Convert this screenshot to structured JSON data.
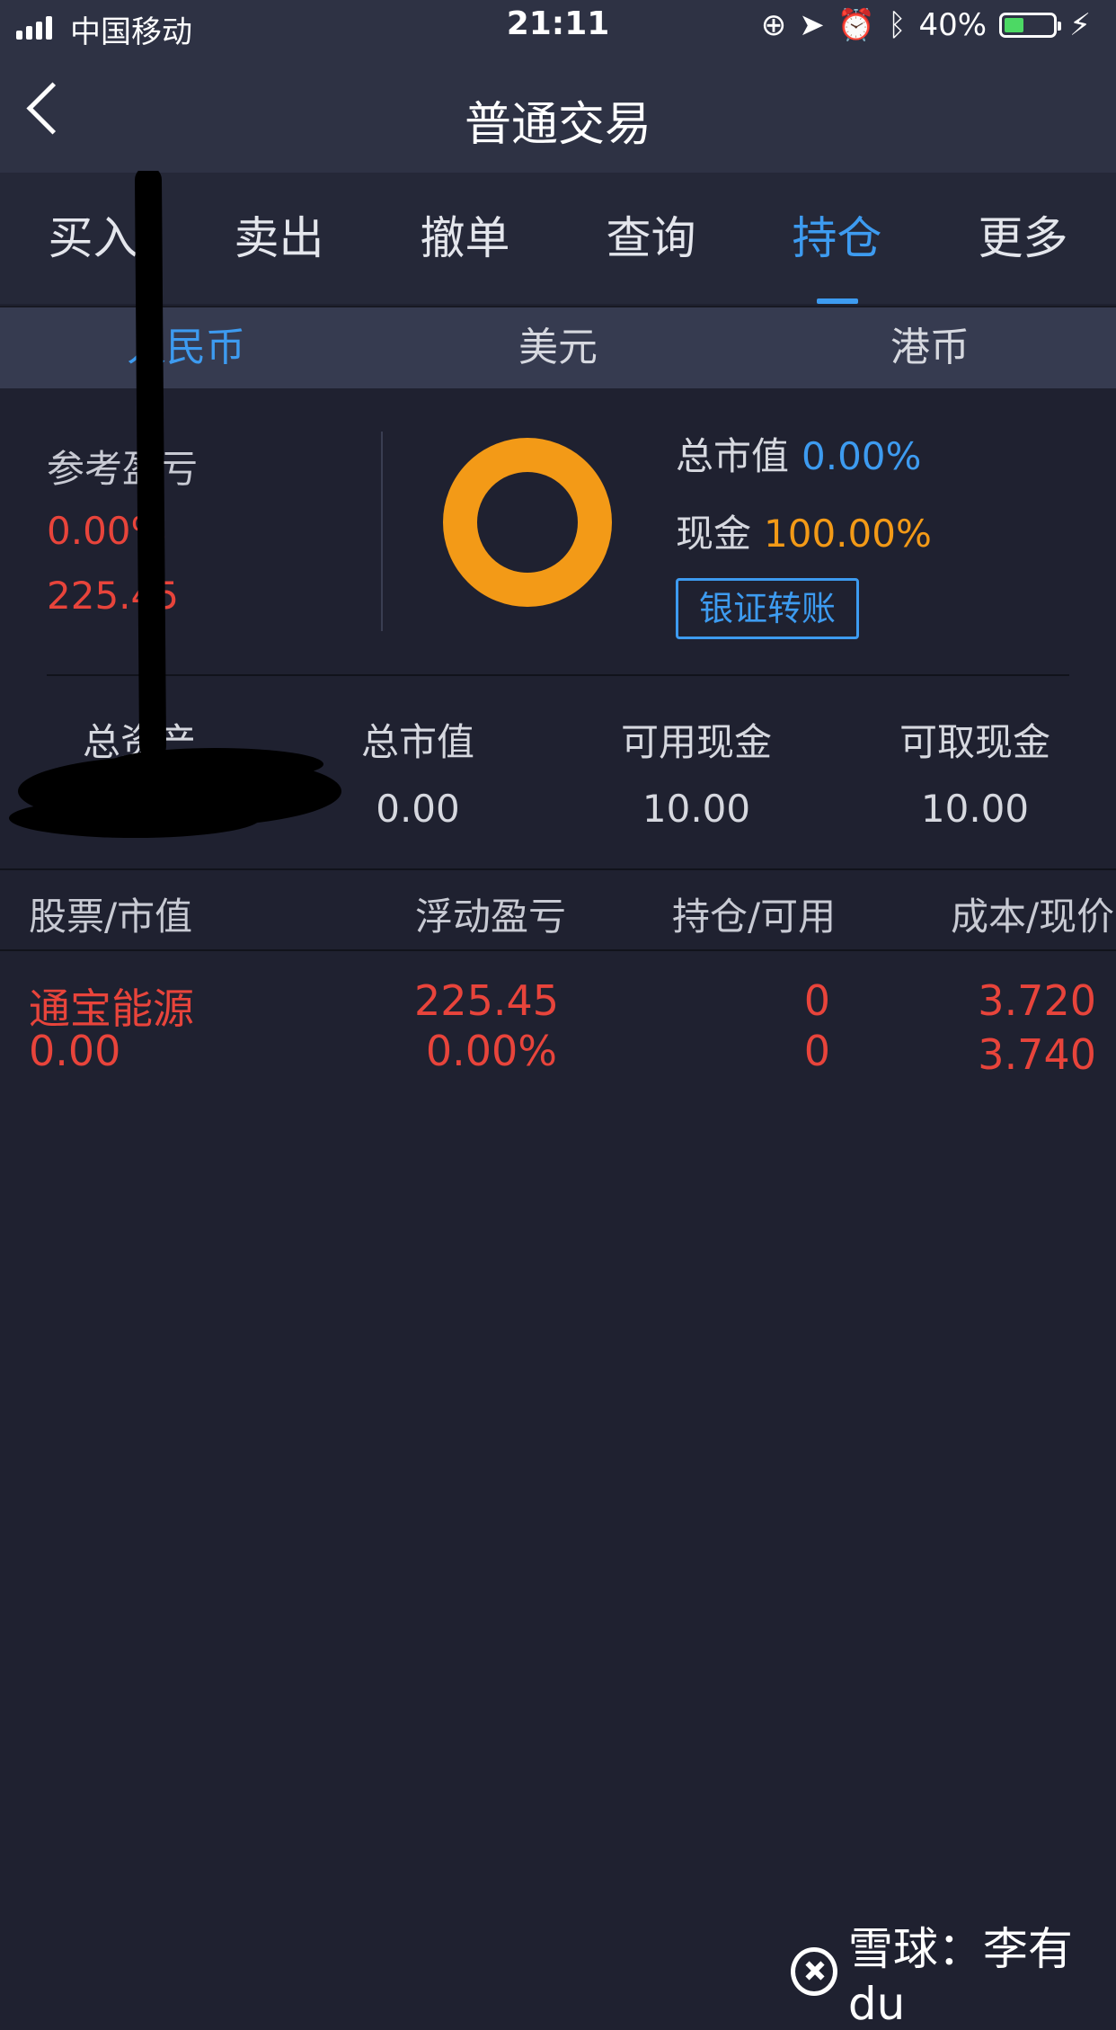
{
  "status_bar": {
    "carrier": "中国移动",
    "time": "21:11",
    "battery": "40%",
    "battery_level": 0.4
  },
  "nav": {
    "title": "普通交易"
  },
  "tabs": [
    {
      "label": "买入"
    },
    {
      "label": "卖出"
    },
    {
      "label": "撤单"
    },
    {
      "label": "查询"
    },
    {
      "label": "持仓",
      "active": true
    },
    {
      "label": "更多"
    }
  ],
  "currencies": [
    {
      "label": "人民币",
      "active": true
    },
    {
      "label": "美元"
    },
    {
      "label": "港币"
    }
  ],
  "summary": {
    "pl_label": "参考盈亏",
    "pl_percent": "0.00%",
    "pl_value": "225.45",
    "market_value_label": "总市值",
    "market_value_pct": "0.00%",
    "cash_label": "现金",
    "cash_pct": "100.00%",
    "transfer_button": "银证转账",
    "donut": {
      "cash_share": 1.0,
      "market_share": 0.0,
      "cash_color": "#f39a17",
      "market_color": "#3d9bf0"
    }
  },
  "stats": [
    {
      "title": "总资产",
      "value": ""
    },
    {
      "title": "总市值",
      "value": "0.00"
    },
    {
      "title": "可用现金",
      "value": "10.00"
    },
    {
      "title": "可取现金",
      "value": "10.00"
    }
  ],
  "holdings": {
    "headers": [
      "股票/市值",
      "浮动盈亏",
      "持仓/可用",
      "成本/现价"
    ],
    "rows": [
      {
        "name": "通宝能源",
        "market_value": "0.00",
        "float_pl": "225.45",
        "float_pl_pct": "0.00%",
        "position": "0",
        "available": "0",
        "cost": "3.720",
        "price": "3.740"
      }
    ]
  },
  "watermark": {
    "text": "雪球：李有du"
  },
  "colors": {
    "accent": "#3d9bf0",
    "loss_red": "#e8443b",
    "cash_orange": "#f39a17",
    "background": "#1f2130"
  }
}
